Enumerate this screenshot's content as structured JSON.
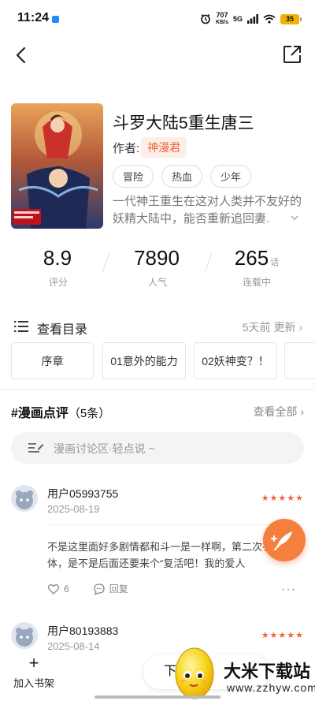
{
  "status_bar": {
    "time": "11:24",
    "net_speed_value": "707",
    "net_speed_unit": "KB/s",
    "network": "5G",
    "battery": "35"
  },
  "book": {
    "title": "斗罗大陆5重生唐三",
    "author_label": "作者:",
    "author": "神漫君",
    "tags": [
      "冒险",
      "热血",
      "少年"
    ],
    "description": "一代神王重生在这对人类并不友好的妖精大陆中，能否重新追回妻."
  },
  "stats": [
    {
      "value": "8.9",
      "unit": "",
      "label": "评分"
    },
    {
      "value": "7890",
      "unit": "",
      "label": "人气"
    },
    {
      "value": "265",
      "unit": "话",
      "label": "连载中"
    }
  ],
  "catalog": {
    "label": "查看目录",
    "update": "5天前 更新 ›",
    "chapters": [
      "序章",
      "01意外的能力",
      "02妖神变？！"
    ]
  },
  "reviews": {
    "title": "#漫画点评",
    "count": "（5条）",
    "view_all": "查看全部 ›",
    "discuss_placeholder": "漫画讨论区·轻点说 ~",
    "items": [
      {
        "user": "用户05993755",
        "date": "2025-08-19",
        "stars": "★★★★★",
        "text": "不是这里面好多剧情都和斗一是一样啊，第二次有冰火连体，是不是后面还要来个“复活吧！我的爱人",
        "likes": "6",
        "reply_label": "回复",
        "more": "···"
      },
      {
        "user": "用户80193883",
        "date": "2025-08-14",
        "stars": "★★★★★"
      }
    ]
  },
  "bottom": {
    "add_shelf_icon": "+",
    "add_shelf_label": "加入书架",
    "next_button": "下"
  },
  "watermark": {
    "name": "大米下载站",
    "url": "www.zzhyw.com"
  }
}
